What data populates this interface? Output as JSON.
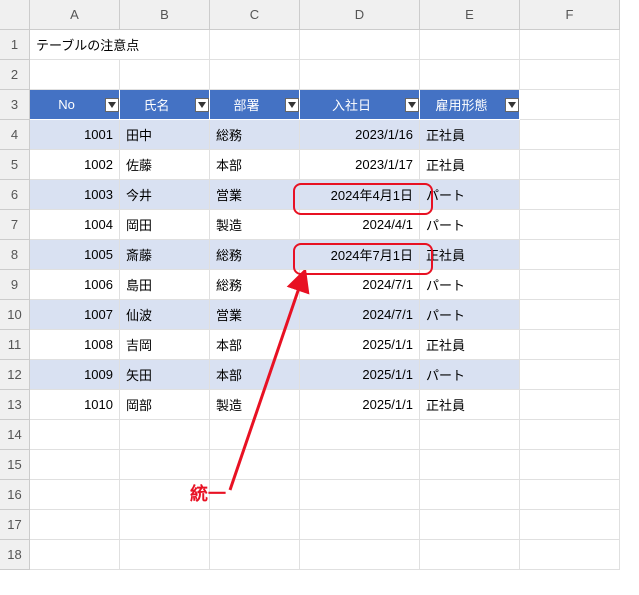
{
  "title": "テーブルの注意点",
  "columns": [
    "A",
    "B",
    "C",
    "D",
    "E",
    "F"
  ],
  "row_numbers": [
    1,
    2,
    3,
    4,
    5,
    6,
    7,
    8,
    9,
    10,
    11,
    12,
    13,
    14,
    15,
    16,
    17,
    18
  ],
  "headers": {
    "no": "No",
    "name": "氏名",
    "dept": "部署",
    "hire": "入社日",
    "emp": "雇用形態"
  },
  "rows": [
    {
      "no": "1001",
      "name": "田中",
      "dept": "総務",
      "hire": "2023/1/16",
      "emp": "正社員"
    },
    {
      "no": "1002",
      "name": "佐藤",
      "dept": "本部",
      "hire": "2023/1/17",
      "emp": "正社員"
    },
    {
      "no": "1003",
      "name": "今井",
      "dept": "営業",
      "hire": "2024年4月1日",
      "emp": "パート"
    },
    {
      "no": "1004",
      "name": "岡田",
      "dept": "製造",
      "hire": "2024/4/1",
      "emp": "パート"
    },
    {
      "no": "1005",
      "name": "斎藤",
      "dept": "総務",
      "hire": "2024年7月1日",
      "emp": "正社員"
    },
    {
      "no": "1006",
      "name": "島田",
      "dept": "総務",
      "hire": "2024/7/1",
      "emp": "パート"
    },
    {
      "no": "1007",
      "name": "仙波",
      "dept": "営業",
      "hire": "2024/7/1",
      "emp": "パート"
    },
    {
      "no": "1008",
      "name": "吉岡",
      "dept": "本部",
      "hire": "2025/1/1",
      "emp": "正社員"
    },
    {
      "no": "1009",
      "name": "矢田",
      "dept": "本部",
      "hire": "2025/1/1",
      "emp": "パート"
    },
    {
      "no": "1010",
      "name": "岡部",
      "dept": "製造",
      "hire": "2025/1/1",
      "emp": "正社員"
    }
  ],
  "annotation": "統一",
  "chart_data": {
    "type": "table",
    "title": "テーブルの注意点",
    "columns": [
      "No",
      "氏名",
      "部署",
      "入社日",
      "雇用形態"
    ],
    "data": [
      [
        1001,
        "田中",
        "総務",
        "2023/1/16",
        "正社員"
      ],
      [
        1002,
        "佐藤",
        "本部",
        "2023/1/17",
        "正社員"
      ],
      [
        1003,
        "今井",
        "営業",
        "2024年4月1日",
        "パート"
      ],
      [
        1004,
        "岡田",
        "製造",
        "2024/4/1",
        "パート"
      ],
      [
        1005,
        "斎藤",
        "総務",
        "2024年7月1日",
        "正社員"
      ],
      [
        1006,
        "島田",
        "総務",
        "2024/7/1",
        "パート"
      ],
      [
        1007,
        "仙波",
        "営業",
        "2024/7/1",
        "パート"
      ],
      [
        1008,
        "吉岡",
        "本部",
        "2025/1/1",
        "正社員"
      ],
      [
        1009,
        "矢田",
        "本部",
        "2025/1/1",
        "パート"
      ],
      [
        1010,
        "岡部",
        "製造",
        "2025/1/1",
        "正社員"
      ]
    ],
    "highlighted_cells": [
      "D6",
      "D8"
    ],
    "annotation": "統一"
  }
}
